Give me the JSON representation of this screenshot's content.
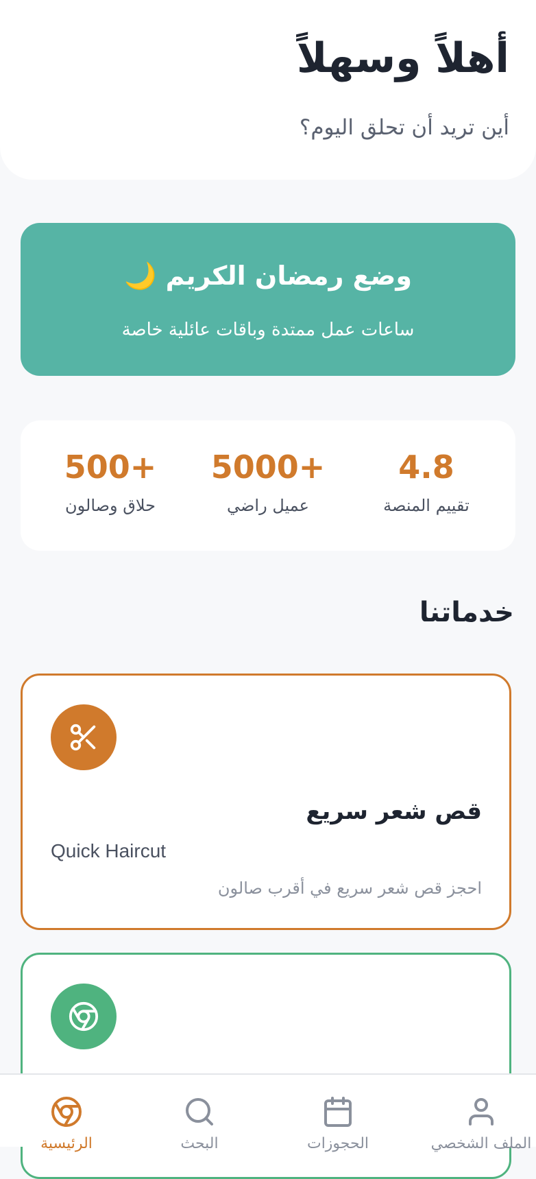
{
  "header": {
    "greeting": "أهلاً وسهلاً",
    "subtitle": "أين تريد أن تحلق اليوم؟"
  },
  "ramadan_banner": {
    "moon": "🌙",
    "title": "وضع رمضان الكريم",
    "subtitle": "ساعات عمل ممتدة وباقات عائلية خاصة"
  },
  "stats": [
    {
      "value": "4.8",
      "label": "تقييم المنصة"
    },
    {
      "value": "5000+",
      "label": "عميل راضي"
    },
    {
      "value": "500+",
      "label": "حلاق وصالون"
    }
  ],
  "services": {
    "section_title": "خدماتنا",
    "items": [
      {
        "icon": "scissors-icon",
        "title_ar": "قص شعر سريع",
        "title_en": "Quick Haircut",
        "description": "احجز قص شعر سريع في أقرب صالون",
        "accent": "#d07a2c"
      },
      {
        "icon": "chrome-icon",
        "accent": "#4fb37f"
      }
    ]
  },
  "bottom_nav": {
    "items": [
      {
        "icon": "home-icon",
        "label": "الرئيسية",
        "active": true
      },
      {
        "icon": "search-icon",
        "label": "البحث",
        "active": false
      },
      {
        "icon": "calendar-icon",
        "label": "الحجوزات",
        "active": false
      },
      {
        "icon": "user-icon",
        "label": "الملف الشخصي",
        "active": false
      }
    ]
  },
  "colors": {
    "accent_orange": "#d07a2c",
    "teal": "#56b4a5",
    "green": "#4fb37f",
    "background": "#f7f8fa"
  }
}
